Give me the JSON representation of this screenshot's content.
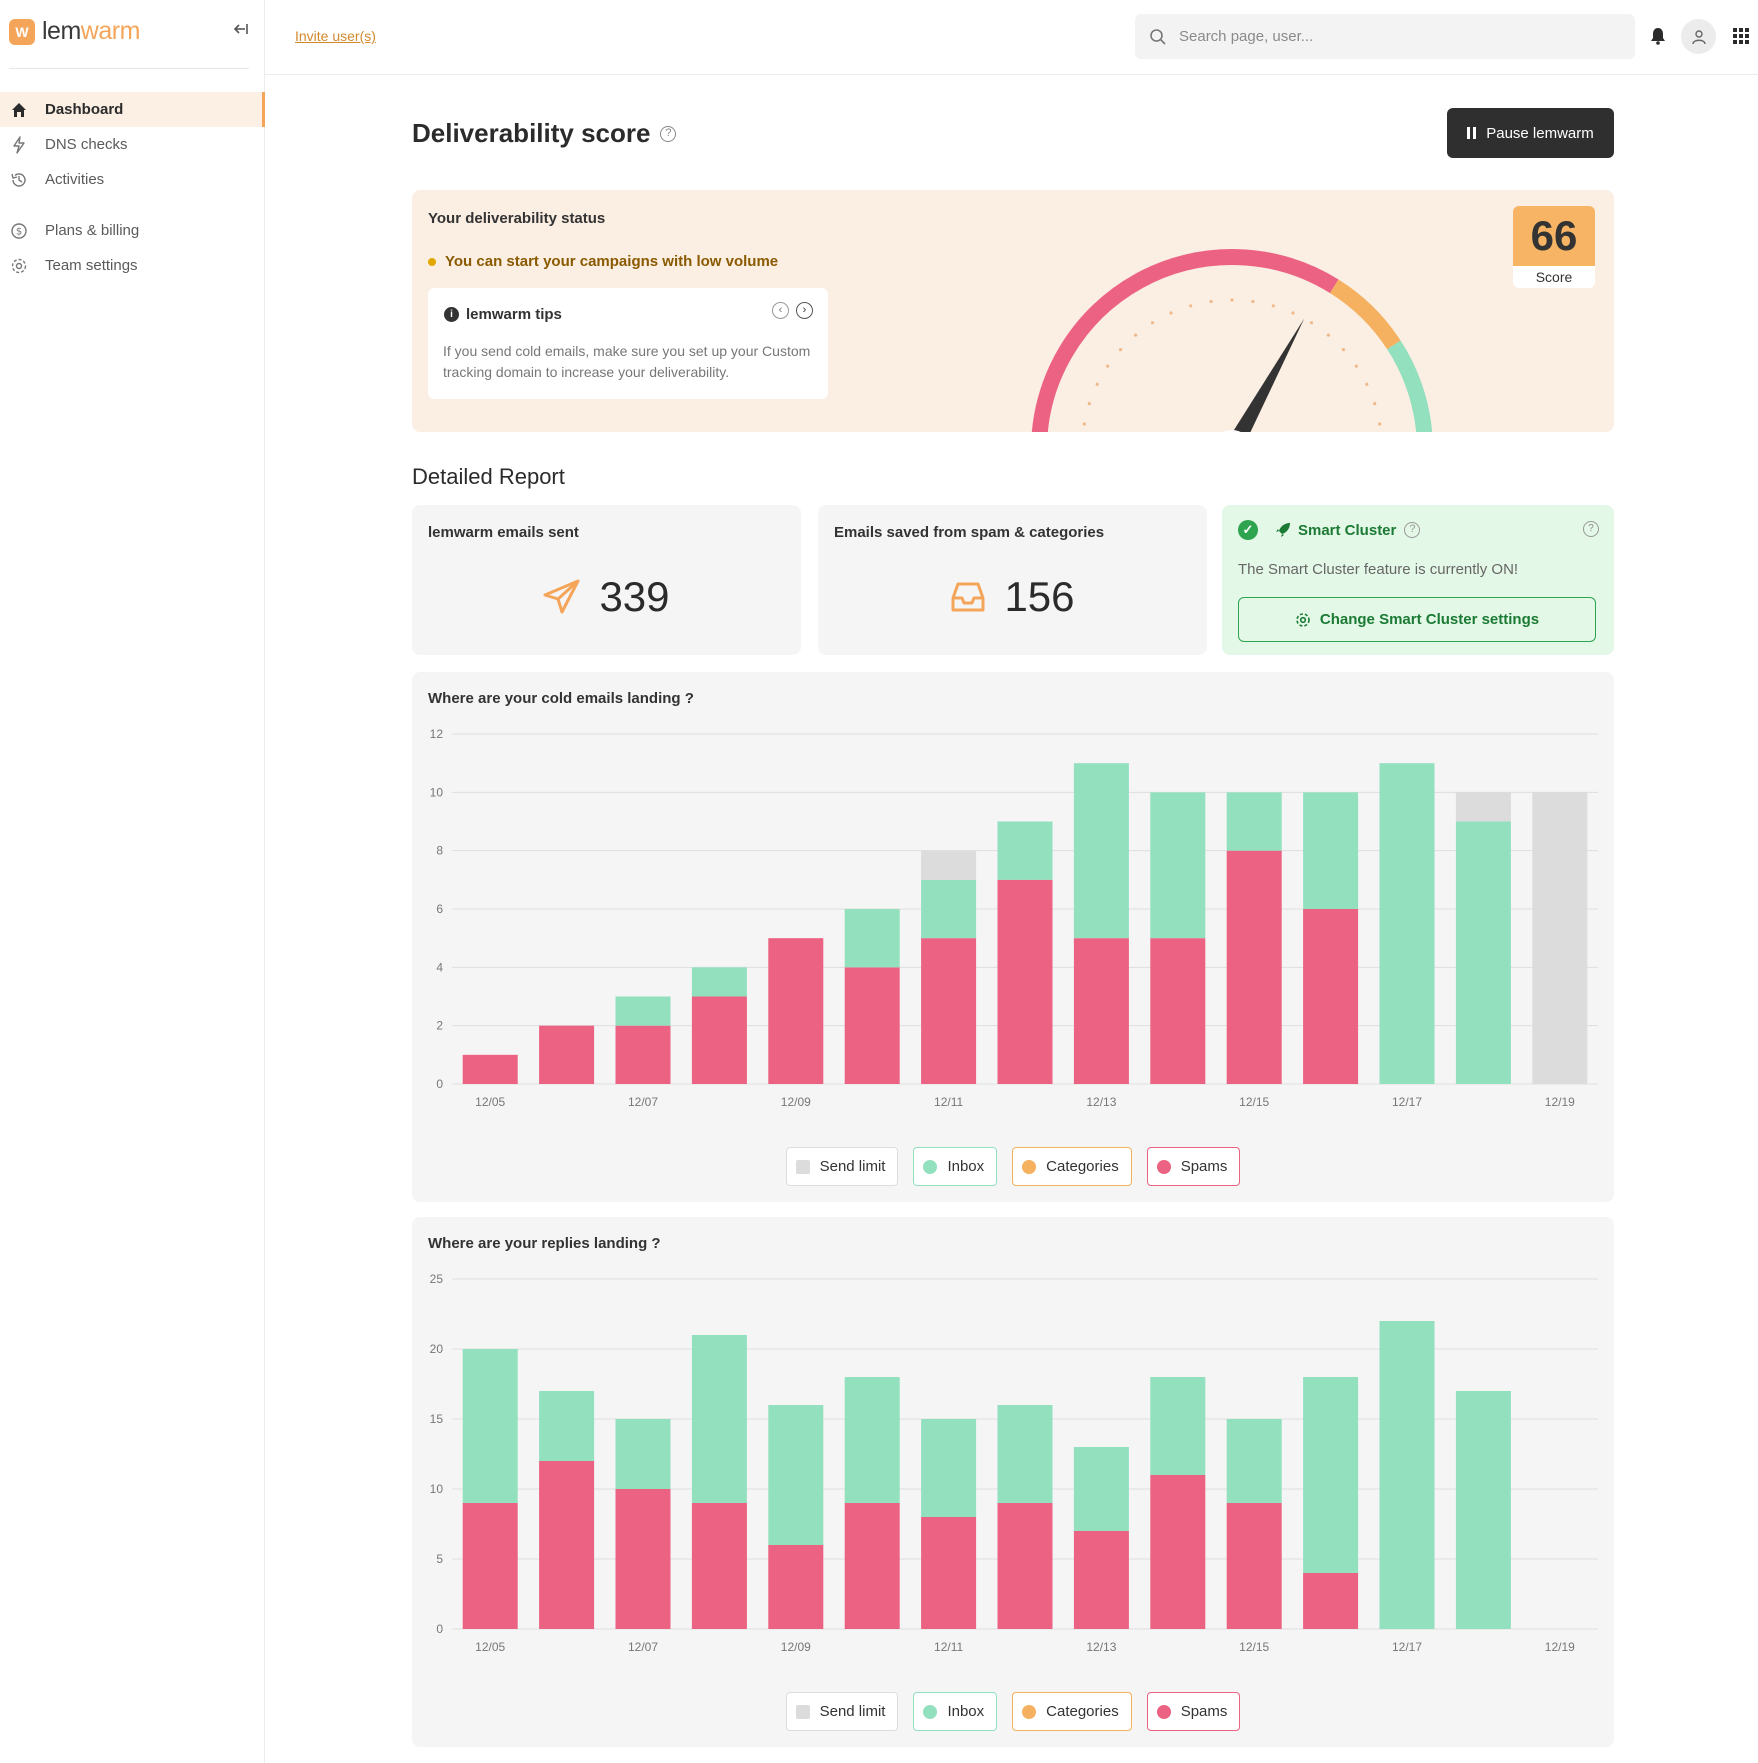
{
  "app": {
    "logo_mark": "W",
    "logo_text_a": "lem",
    "logo_text_b": "warm"
  },
  "sidebar": {
    "items": [
      {
        "label": "Dashboard",
        "icon": "home-icon",
        "active": true
      },
      {
        "label": "DNS checks",
        "icon": "bolt-icon"
      },
      {
        "label": "Activities",
        "icon": "history-icon"
      },
      {
        "label": "Plans & billing",
        "icon": "dollar-icon"
      },
      {
        "label": "Team settings",
        "icon": "gear-icon"
      }
    ]
  },
  "header": {
    "invite_label": "Invite user(s)",
    "search_placeholder": "Search page, user..."
  },
  "page": {
    "title": "Deliverability score",
    "pause_label": "Pause lemwarm"
  },
  "status": {
    "title": "Your deliverability status",
    "message": "You can start your campaigns with low volume",
    "tips_title": "lemwarm tips",
    "tips_body": "If you send cold emails, make sure you set up your Custom tracking domain to increase your deliverability.",
    "score": "66",
    "score_label": "Score",
    "score_value": 66
  },
  "report": {
    "title": "Detailed Report",
    "sent_label": "lemwarm emails sent",
    "sent_value": "339",
    "saved_label": "Emails saved from spam & categories",
    "saved_value": "156",
    "cluster_title": "Smart Cluster",
    "cluster_text": "The Smart Cluster feature is currently ON!",
    "cluster_button": "Change Smart Cluster settings"
  },
  "legend": {
    "send_limit": "Send limit",
    "inbox": "Inbox",
    "categories": "Categories",
    "spams": "Spams"
  },
  "colors": {
    "inbox": "#93e0bf",
    "spam": "#ec6283",
    "categories": "#f5b160",
    "send_limit": "#dcdcdc",
    "accent": "#f5a55a"
  },
  "chart_data": [
    {
      "type": "bar",
      "title": "Where are your cold emails landing ?",
      "stacked": true,
      "x": [
        "12/05",
        "12/06",
        "12/07",
        "12/08",
        "12/09",
        "12/10",
        "12/11",
        "12/12",
        "12/13",
        "12/14",
        "12/15",
        "12/16",
        "12/17",
        "12/18",
        "12/19"
      ],
      "xticks": [
        "12/05",
        "12/07",
        "12/09",
        "12/11",
        "12/13",
        "12/15",
        "12/17",
        "12/19"
      ],
      "ylim": [
        0,
        12
      ],
      "yticks": [
        0,
        2,
        4,
        6,
        8,
        10,
        12
      ],
      "series": [
        {
          "name": "Spams",
          "color": "#ec6283",
          "values": [
            1,
            2,
            2,
            3,
            5,
            4,
            5,
            7,
            5,
            5,
            8,
            6,
            0,
            0,
            0
          ]
        },
        {
          "name": "Inbox",
          "color": "#93e0bf",
          "values": [
            0,
            0,
            1,
            1,
            0,
            2,
            2,
            2,
            6,
            5,
            2,
            4,
            11,
            9,
            0
          ]
        },
        {
          "name": "Send limit",
          "color": "#dcdcdc",
          "values": [
            0,
            0,
            0,
            0,
            0,
            0,
            1,
            0,
            0,
            0,
            0,
            0,
            0,
            1,
            10
          ]
        }
      ]
    },
    {
      "type": "bar",
      "title": "Where are your replies landing ?",
      "stacked": true,
      "x": [
        "12/05",
        "12/06",
        "12/07",
        "12/08",
        "12/09",
        "12/10",
        "12/11",
        "12/12",
        "12/13",
        "12/14",
        "12/15",
        "12/16",
        "12/17",
        "12/18",
        "12/19"
      ],
      "xticks": [
        "12/05",
        "12/07",
        "12/09",
        "12/11",
        "12/13",
        "12/15",
        "12/17",
        "12/19"
      ],
      "ylim": [
        0,
        25
      ],
      "yticks": [
        0,
        5,
        10,
        15,
        20,
        25
      ],
      "series": [
        {
          "name": "Spams",
          "color": "#ec6283",
          "values": [
            9,
            12,
            10,
            9,
            6,
            9,
            8,
            9,
            7,
            11,
            9,
            4,
            0,
            0,
            0
          ]
        },
        {
          "name": "Inbox",
          "color": "#93e0bf",
          "values": [
            11,
            5,
            5,
            12,
            10,
            9,
            7,
            7,
            6,
            7,
            6,
            14,
            22,
            17,
            0
          ]
        }
      ]
    }
  ]
}
